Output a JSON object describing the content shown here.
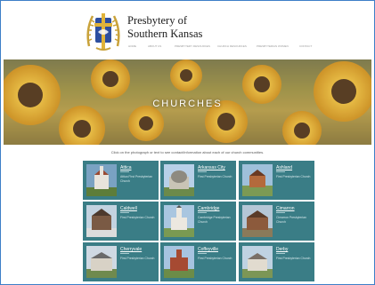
{
  "header": {
    "title_line1": "Presbytery of",
    "title_line2": "Southern Kansas",
    "nav": [
      "Home",
      "About Us",
      "Presbytery Resources",
      "Church Resources",
      "Presbyterian Women",
      "Contact"
    ]
  },
  "hero": {
    "title": "CHURCHES"
  },
  "intro": "Click on the photograph or text to see contact/information about each of our church communities.",
  "churches": [
    {
      "name": "Attica",
      "desc": "Attica First Presbyterian Church"
    },
    {
      "name": "Arkansas City",
      "desc": "First Presbyterian Church"
    },
    {
      "name": "Ashland",
      "desc": "First Presbyterian Church"
    },
    {
      "name": "Caldwell",
      "desc": "First Presbyterian Church"
    },
    {
      "name": "Cambridge",
      "desc": "Cambridge Presbyterian Church"
    },
    {
      "name": "Cimarron",
      "desc": "Cimarron Presbyterian Church"
    },
    {
      "name": "Cherryvale",
      "desc": "First Presbyterian Church"
    },
    {
      "name": "Coffeyville",
      "desc": "First Presbyterian Church"
    },
    {
      "name": "Derby",
      "desc": "First Presbyterian Church"
    }
  ],
  "colors": {
    "tile": "#3a7d86",
    "frame": "#3d7fc8"
  }
}
